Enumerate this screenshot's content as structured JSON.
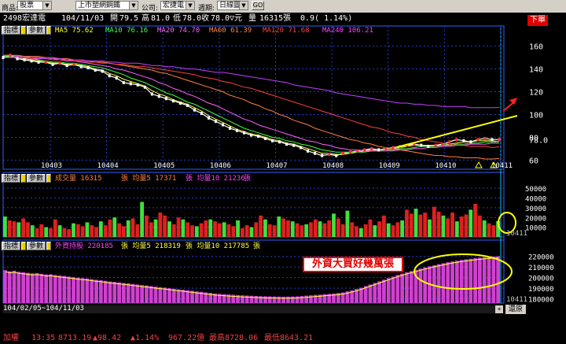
{
  "toolbar": {
    "item1_label": "商品:",
    "item1_value": "股票",
    "item2_value": "上市塑網鋼鐵",
    "item3_label": "公司:",
    "item3_value": "宏捷電",
    "item4_label": "週期:",
    "item4_value": "日線圖",
    "go_label": "GO"
  },
  "header": {
    "stock": "2498宏達電",
    "date": "104/11/03",
    "open_label": "開",
    "open": "79.5",
    "high_label": "高",
    "high": "81.0",
    "low_label": "低",
    "low": "78.0",
    "close_label": "收",
    "close": "78.0",
    "chg_label": "▽元",
    "vol_label": "量",
    "vol": "16315張",
    "chg": "0.9( 1.14%)",
    "red_button": "下單"
  },
  "price_panel": {
    "btn1": "指標",
    "btn2": "參數",
    "ma5": "MA5 75.62",
    "ma10": "MA10 76.16",
    "ma20": "MA20 74.70",
    "ma60": "MA60 61.39",
    "ma120": "MA120 71.68",
    "ma240": "MA240 106.21",
    "current_price": "78.0"
  },
  "volume_panel": {
    "btn1": "指標",
    "btn2": "參數",
    "label": "成交量 16315",
    "ma5": "張 均量5 17371",
    "ma10": "張 均量10 21236",
    "tail": "張"
  },
  "foreign_panel": {
    "btn1": "指標",
    "btn2": "參數",
    "label": "外資持股 220185",
    "ma5": "張 均量5 218319",
    "ma10": "張 均量10 217785",
    "tail": "張",
    "annotation": "外資大買好幾萬張"
  },
  "scroll": {
    "restore": "還原"
  },
  "date_range": "104/02/05~104/11/03",
  "footer": {
    "index": "加權",
    "time": "13:35",
    "value": "8713.19",
    "change": "▲98.42",
    "pct": "▲1.14%",
    "amount": "967.22億",
    "high": "最高8728.06",
    "low": "最低8643.21"
  },
  "chart_data": [
    {
      "type": "line",
      "title": "2498宏達電 日線圖",
      "x_tick_labels": [
        "10403",
        "10404",
        "10405",
        "10406",
        "10407",
        "10408",
        "10409",
        "10410",
        "10411"
      ],
      "y_ticks": [
        60,
        80,
        100,
        120,
        140,
        160
      ],
      "ylim": [
        52,
        168
      ],
      "last_price_label": "78.0",
      "series": [
        {
          "name": "Close",
          "values": [
            150,
            152,
            149,
            148,
            147,
            146,
            146,
            144,
            145,
            143,
            144,
            142,
            141,
            139,
            138,
            134,
            132,
            128,
            127,
            126,
            124,
            118,
            116,
            114,
            112,
            110,
            108,
            104,
            101,
            97,
            94,
            91,
            88,
            86,
            84,
            82,
            81,
            79,
            77,
            76,
            74,
            73,
            71,
            68,
            66,
            64,
            65,
            64,
            66,
            67,
            68,
            69,
            70,
            69,
            70,
            71,
            72,
            73,
            74,
            73,
            72,
            73,
            74,
            76,
            78,
            77,
            76,
            78,
            79,
            78,
            78
          ]
        },
        {
          "name": "MA5",
          "values": [
            150,
            151,
            150,
            149,
            148,
            147,
            146,
            145,
            145,
            144,
            144,
            143,
            142,
            140,
            139,
            136,
            134,
            131,
            129,
            127,
            125,
            121,
            118,
            116,
            113,
            111,
            109,
            106,
            103,
            99,
            96,
            93,
            90,
            87,
            85,
            83,
            82,
            80,
            78,
            77,
            75,
            74,
            72,
            70,
            68,
            66,
            66,
            65,
            65,
            66,
            67,
            68,
            69,
            69,
            70,
            70,
            71,
            72,
            73,
            73,
            73,
            73,
            73,
            74,
            75,
            76,
            76,
            77,
            77,
            77,
            76
          ]
        },
        {
          "name": "MA10",
          "values": [
            151,
            151,
            150,
            150,
            149,
            148,
            147,
            146,
            146,
            145,
            145,
            144,
            143,
            142,
            141,
            139,
            137,
            135,
            132,
            130,
            128,
            125,
            122,
            119,
            117,
            114,
            111,
            109,
            106,
            103,
            100,
            97,
            94,
            91,
            88,
            86,
            84,
            82,
            80,
            79,
            77,
            76,
            74,
            73,
            71,
            69,
            68,
            67,
            67,
            67,
            67,
            67,
            68,
            68,
            69,
            69,
            70,
            70,
            71,
            72,
            72,
            72,
            73,
            73,
            74,
            74,
            75,
            75,
            76,
            76,
            76
          ]
        },
        {
          "name": "MA20",
          "values": [
            152,
            152,
            151,
            151,
            150,
            150,
            149,
            149,
            148,
            147,
            147,
            146,
            145,
            144,
            143,
            142,
            140,
            139,
            137,
            135,
            133,
            131,
            128,
            126,
            123,
            121,
            118,
            116,
            113,
            110,
            108,
            105,
            102,
            99,
            96,
            94,
            91,
            89,
            87,
            85,
            83,
            81,
            79,
            77,
            76,
            74,
            73,
            71,
            70,
            69,
            69,
            68,
            68,
            68,
            68,
            68,
            69,
            69,
            70,
            70,
            71,
            71,
            72,
            72,
            73,
            73,
            74,
            74,
            74,
            75,
            74.7
          ]
        },
        {
          "name": "MA60",
          "values": [
            152,
            152,
            152,
            151,
            151,
            151,
            150,
            150,
            149,
            149,
            148,
            148,
            147,
            146,
            146,
            145,
            144,
            143,
            142,
            141,
            140,
            139,
            137,
            136,
            134,
            132,
            130,
            128,
            126,
            124,
            122,
            120,
            117,
            115,
            113,
            110,
            108,
            105,
            103,
            100,
            98,
            95,
            93,
            91,
            88,
            86,
            84,
            82,
            80,
            78,
            77,
            75,
            74,
            72,
            71,
            70,
            69,
            68,
            67,
            66,
            65,
            64,
            64,
            63,
            63,
            62,
            62,
            62,
            61,
            61,
            61.4
          ]
        },
        {
          "name": "MA120",
          "values": [
            150,
            150,
            150,
            150,
            149,
            149,
            149,
            148,
            148,
            148,
            147,
            147,
            146,
            146,
            145,
            145,
            144,
            144,
            143,
            142,
            142,
            141,
            140,
            139,
            138,
            137,
            136,
            135,
            133,
            132,
            131,
            129,
            128,
            126,
            124,
            123,
            121,
            119,
            117,
            115,
            113,
            111,
            109,
            107,
            105,
            103,
            101,
            99,
            97,
            95,
            93,
            91,
            89,
            88,
            86,
            84,
            83,
            81,
            80,
            78,
            77,
            76,
            75,
            74,
            73,
            73,
            72,
            72,
            72,
            71,
            71.7
          ]
        },
        {
          "name": "MA240",
          "values": [
            150,
            150,
            150,
            150,
            150,
            149,
            149,
            149,
            149,
            148,
            148,
            148,
            147,
            147,
            147,
            146,
            146,
            145,
            145,
            145,
            144,
            143,
            143,
            142,
            142,
            141,
            140,
            140,
            139,
            138,
            137,
            137,
            136,
            135,
            134,
            133,
            132,
            131,
            130,
            129,
            128,
            126,
            125,
            124,
            123,
            122,
            121,
            119,
            118,
            117,
            116,
            115,
            114,
            113,
            112,
            111,
            110,
            110,
            109,
            109,
            108,
            108,
            107,
            107,
            107,
            107,
            106,
            106,
            106,
            106,
            106.2
          ]
        }
      ]
    },
    {
      "type": "bar",
      "title": "成交量",
      "y_ticks": [
        10000,
        20000,
        30000,
        40000,
        50000
      ],
      "ylim": [
        0,
        55000
      ],
      "x_edge_label": "10411",
      "values": [
        21000,
        17000,
        16000,
        15000,
        19000,
        15000,
        12000,
        9000,
        13000,
        10000,
        9000,
        18000,
        12000,
        9000,
        8000,
        14000,
        13000,
        11000,
        15000,
        12000,
        10000,
        16000,
        12000,
        18000,
        20000,
        14000,
        11000,
        17000,
        19000,
        13000,
        36000,
        22000,
        15000,
        18000,
        25000,
        22000,
        16000,
        13000,
        20000,
        18000,
        15000,
        12000,
        11000,
        14000,
        17000,
        18000,
        16000,
        14000,
        15000,
        13000,
        11000,
        17000,
        9000,
        12000,
        10000,
        15000,
        22000,
        18000,
        13000,
        12000,
        21000,
        19000,
        17000,
        16000,
        14000,
        12000,
        13000,
        15000,
        18000,
        16000,
        14000,
        17000,
        24000,
        19000,
        13000,
        27000,
        15000,
        11000,
        9000,
        13000,
        18000,
        12000,
        16000,
        22000,
        14000,
        12000,
        15000,
        17000,
        28000,
        24000,
        29000,
        23000,
        25000,
        18000,
        31000,
        26000,
        22000,
        19000,
        25000,
        16000,
        21000,
        23000,
        28000,
        34000,
        22000,
        17000,
        14000,
        12000,
        16315
      ]
    },
    {
      "type": "bar",
      "title": "外資持股",
      "y_ticks": [
        180000,
        190000,
        200000,
        210000,
        220000
      ],
      "ylim": [
        176000,
        225000
      ],
      "x_edge_label": "10411",
      "annotation": "外資大買好幾萬張",
      "values": [
        207000,
        206000,
        206500,
        205500,
        205000,
        204500,
        204000,
        204300,
        203600,
        203000,
        203200,
        202500,
        202000,
        201600,
        201000,
        200500,
        200000,
        199500,
        199200,
        198600,
        198000,
        197500,
        197000,
        196400,
        196000,
        195500,
        195000,
        194600,
        194000,
        193500,
        193000,
        192600,
        192000,
        191500,
        191000,
        190600,
        190000,
        189500,
        189000,
        188600,
        188000,
        187600,
        187000,
        186600,
        186000,
        185600,
        185000,
        184700,
        184400,
        184100,
        183800,
        183500,
        183300,
        183100,
        182900,
        182700,
        182500,
        182400,
        182300,
        182200,
        182100,
        182000,
        182100,
        182200,
        182300,
        182600,
        183000,
        183300,
        183700,
        184000,
        184400,
        184700,
        185000,
        185500,
        186000,
        187000,
        188000,
        189200,
        190500,
        192000,
        193500,
        195000,
        196500,
        198000,
        199500,
        201000,
        202500,
        203800,
        205000,
        206200,
        207400,
        208500,
        209600,
        210700,
        211700,
        212700,
        213600,
        214500,
        215300,
        216000,
        216700,
        217300,
        217800,
        218300,
        218800,
        219200,
        219600,
        219900,
        220185
      ]
    }
  ]
}
